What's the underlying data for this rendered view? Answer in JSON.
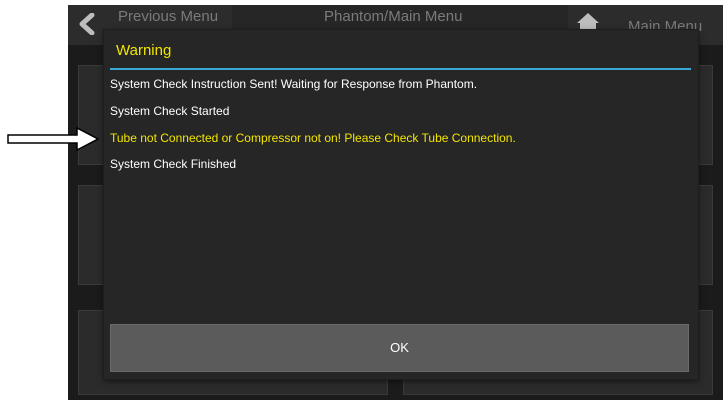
{
  "background_screen": {
    "previous_menu_label": "Previous Menu",
    "breadcrumb": "Phantom/Main Menu",
    "main_menu_label": "Main Menu"
  },
  "dialog": {
    "title": "Warning",
    "messages": [
      {
        "text": "System Check Instruction Sent! Waiting for Response from Phantom.",
        "color": "#ffffff"
      },
      {
        "text": "System Check Started",
        "color": "#ffffff"
      },
      {
        "text": "Tube not Connected or Compressor not on! Please Check Tube Connection.",
        "color": "#f2e600"
      },
      {
        "text": "System Check Finished",
        "color": "#ffffff"
      }
    ],
    "ok_label": "OK"
  },
  "annotation": {
    "icon": "right-arrow-icon"
  },
  "colors": {
    "title": "#f2e600",
    "warning_text": "#f2e600",
    "title_rule": "#3aa7d6",
    "dialog_bg": "#262626",
    "ok_button_bg": "#5b5b5b"
  }
}
